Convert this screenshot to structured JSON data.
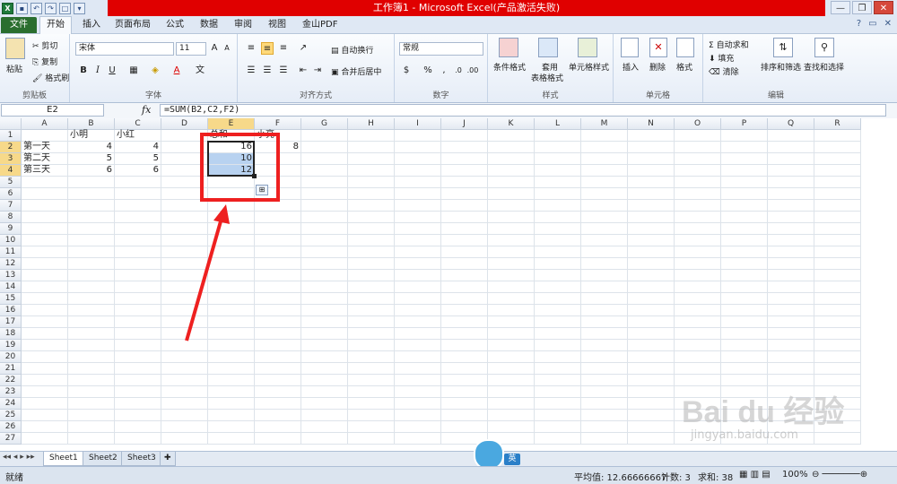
{
  "window": {
    "title": "工作簿1 - Microsoft Excel(产品激活失败)"
  },
  "tabs": [
    "文件",
    "开始",
    "插入",
    "页面布局",
    "公式",
    "数据",
    "审阅",
    "视图",
    "金山PDF"
  ],
  "ribbon": {
    "clipboard": {
      "paste": "粘贴",
      "cut": "剪切",
      "copy": "复制",
      "format_painter": "格式刷",
      "label": "剪贴板"
    },
    "font": {
      "name": "宋体",
      "size": "11",
      "label": "字体"
    },
    "alignment": {
      "wrap": "自动换行",
      "merge": "合并后居中",
      "label": "对齐方式"
    },
    "number": {
      "format": "常规",
      "label": "数字"
    },
    "styles": {
      "conditional": "条件格式",
      "table1": "套用",
      "table2": "表格格式",
      "cell_styles": "单元格样式",
      "label": "样式"
    },
    "cells": {
      "insert": "插入",
      "delete": "删除",
      "format": "格式",
      "label": "单元格"
    },
    "editing": {
      "autosum": "自动求和",
      "fill": "填充",
      "clear": "清除",
      "sort": "排序和筛选",
      "find": "查找和选择",
      "label": "编辑"
    }
  },
  "formula_bar": {
    "name_box": "E2",
    "fx": "fx",
    "formula": "=SUM(B2,C2,F2)"
  },
  "columns": [
    "A",
    "B",
    "C",
    "D",
    "E",
    "F",
    "G",
    "H",
    "I",
    "J",
    "K",
    "L",
    "M",
    "N",
    "O",
    "P",
    "Q",
    "R"
  ],
  "cells": {
    "B1": "小明",
    "C1": "小红",
    "E1": "总和",
    "F1": "小亮",
    "A2": "第一天",
    "B2": "4",
    "C2": "4",
    "E2": "16",
    "F2": "8",
    "A3": "第二天",
    "B3": "5",
    "C3": "5",
    "E3": "10",
    "A4": "第三天",
    "B4": "6",
    "C4": "6",
    "E4": "12"
  },
  "sheets": [
    "Sheet1",
    "Sheet2",
    "Sheet3"
  ],
  "status": {
    "ready": "就绪",
    "average": "平均值: 12.66666667",
    "count": "计数: 3",
    "sum": "求和: 38",
    "zoom": "100%",
    "ime": "英"
  },
  "watermark": {
    "brand": "Bai du 经验",
    "url": "jingyan.baidu.com"
  },
  "colors": {
    "highlight": "#b8d2f0",
    "annotation": "#ee2020",
    "file_tab": "#2a6e2f",
    "title_band": "#e00000"
  }
}
